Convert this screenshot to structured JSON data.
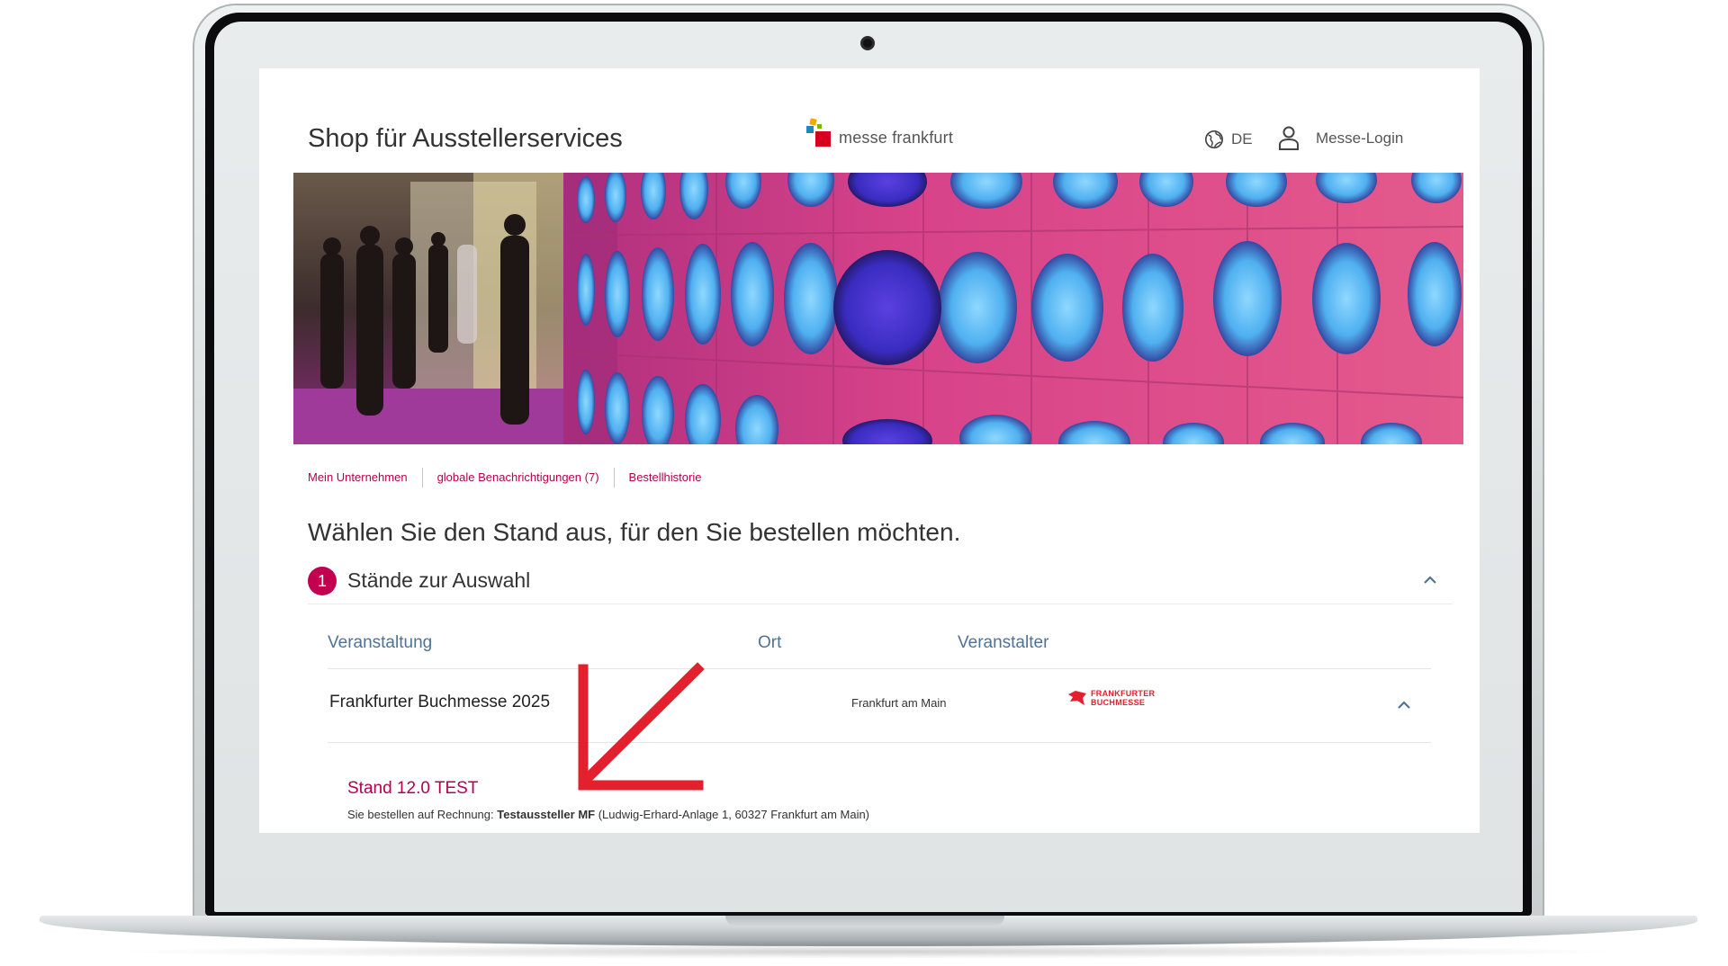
{
  "header": {
    "title": "Shop für Ausstellerservices",
    "logo_text": "messe frankfurt",
    "language": "DE",
    "login_label": "Messe-Login"
  },
  "subnav": {
    "items": [
      {
        "label": "Mein Unternehmen"
      },
      {
        "label": "globale Benachrichtigungen (7)"
      },
      {
        "label": "Bestellhistorie"
      }
    ]
  },
  "main": {
    "heading": "Wählen Sie den Stand aus, für den Sie bestellen möchten.",
    "step": {
      "number": "1",
      "title": "Stände zur Auswahl"
    },
    "table": {
      "columns": [
        "Veranstaltung",
        "Ort",
        "Veranstalter"
      ],
      "row": {
        "event": "Frankfurter Buchmesse 2025",
        "city": "Frankfurt am Main",
        "organizer_logo_line1": "FRANKFURTER",
        "organizer_logo_line2": "BUCHMESSE"
      }
    },
    "stand": {
      "label": "Stand 12.0 TEST",
      "invoice_prefix": "Sie bestellen auf Rechnung: ",
      "invoice_company": "Testaussteller MF",
      "invoice_address": " (Ludwig-Erhard-Anlage 1, 60327 Frankfurt am Main)"
    }
  },
  "colors": {
    "accent": "#c3004f",
    "link": "#b5004e",
    "table_header": "#4e7396",
    "annotation_arrow": "#e3202d"
  },
  "icons": [
    "globe-icon",
    "user-icon",
    "chevron-up-icon",
    "arrow-annotation"
  ]
}
